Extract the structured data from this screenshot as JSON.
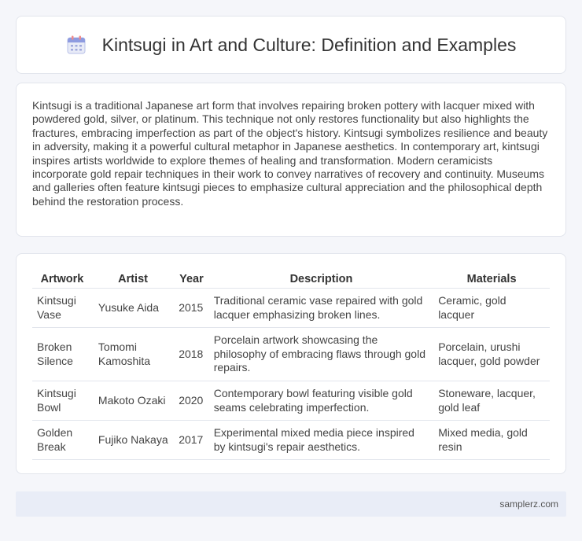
{
  "header": {
    "title": "Kintsugi in Art and Culture: Definition and Examples",
    "icon": "calendar-icon"
  },
  "intro": {
    "text": "Kintsugi is a traditional Japanese art form that involves repairing broken pottery with lacquer mixed with powdered gold, silver, or platinum. This technique not only restores functionality but also highlights the fractures, embracing imperfection as part of the object's history. Kintsugi symbolizes resilience and beauty in adversity, making it a powerful cultural metaphor in Japanese aesthetics. In contemporary art, kintsugi inspires artists worldwide to explore themes of healing and transformation. Modern ceramicists incorporate gold repair techniques in their work to convey narratives of recovery and continuity. Museums and galleries often feature kintsugi pieces to emphasize cultural appreciation and the philosophical depth behind the restoration process."
  },
  "table": {
    "headers": [
      "Artwork",
      "Artist",
      "Year",
      "Description",
      "Materials"
    ],
    "rows": [
      [
        "Kintsugi Vase",
        "Yusuke Aida",
        "2015",
        "Traditional ceramic vase repaired with gold lacquer emphasizing broken lines.",
        "Ceramic, gold lacquer"
      ],
      [
        "Broken Silence",
        "Tomomi Kamoshita",
        "2018",
        "Porcelain artwork showcasing the philosophy of embracing flaws through gold repairs.",
        "Porcelain, urushi lacquer, gold powder"
      ],
      [
        "Kintsugi Bowl",
        "Makoto Ozaki",
        "2020",
        "Contemporary bowl featuring visible gold seams celebrating imperfection.",
        "Stoneware, lacquer, gold leaf"
      ],
      [
        "Golden Break",
        "Fujiko Nakaya",
        "2017",
        "Experimental mixed media piece inspired by kintsugi's repair aesthetics.",
        "Mixed media, gold resin"
      ]
    ]
  },
  "footer": {
    "text": "samplerz.com"
  }
}
